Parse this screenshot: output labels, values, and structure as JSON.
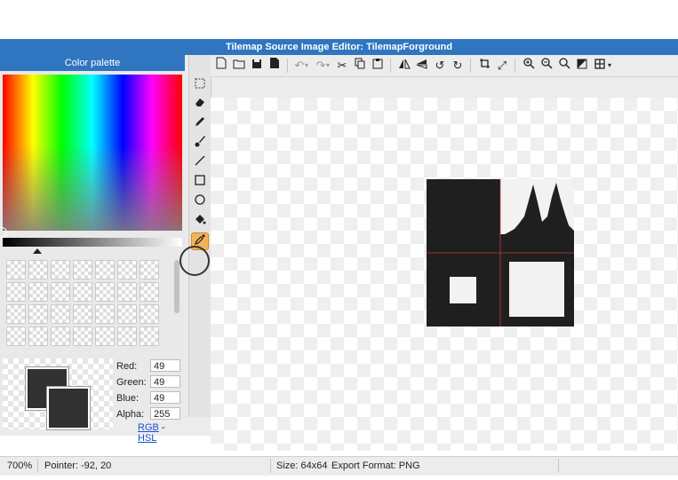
{
  "window": {
    "title": "Tilemap Source Image Editor: TilemapForground"
  },
  "palette": {
    "title": "Color palette",
    "red_label": "Red:",
    "red_value": "49",
    "green_label": "Green:",
    "green_value": "49",
    "blue_label": "Blue:",
    "blue_value": "49",
    "alpha_label": "Alpha:",
    "alpha_value": "255",
    "rgb_link": "RGB",
    "link_separator": "-",
    "hsl_link": "HSL",
    "current_color": "#313131"
  },
  "status": {
    "zoom": "700%",
    "pointer": "Pointer: -92, 20",
    "size": "Size: 64x64",
    "export": "Export Format: PNG"
  },
  "tools": {
    "vertical": [
      "select-icon",
      "eraser-icon",
      "pencil-icon",
      "brush-icon",
      "line-icon",
      "rectangle-icon",
      "ellipse-icon",
      "fill-bucket-icon",
      "color-picker-icon"
    ],
    "active": "color-picker-icon"
  },
  "colors": {
    "accent": "#2f75c0",
    "tile_fill": "#1f1f1f",
    "tile_light": "#f2f2f2",
    "grid_line": "#c43b3b",
    "active_tool": "#f3b25c"
  }
}
